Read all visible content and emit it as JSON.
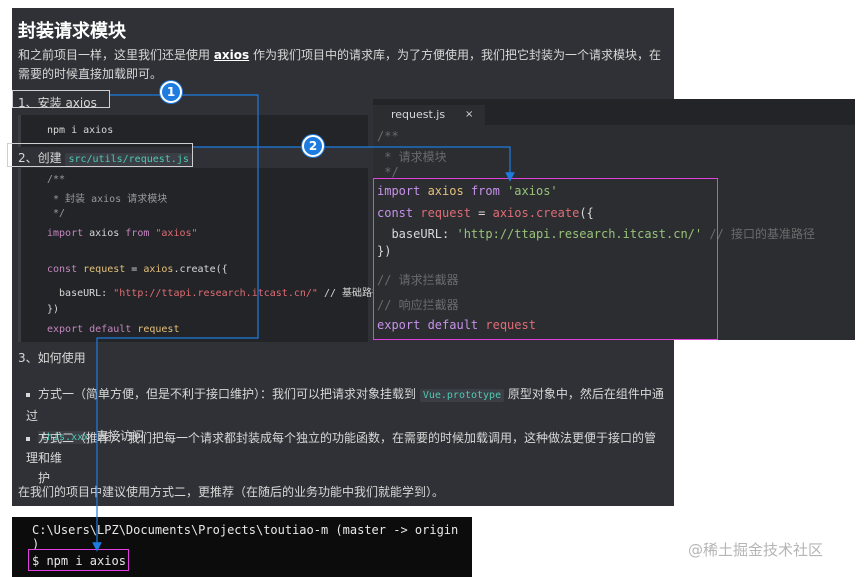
{
  "doc": {
    "title": "封装请求模块",
    "intro_before": "和之前项目一样，这里我们还是使用 ",
    "intro_kw": "axios",
    "intro_after": " 作为我们项目中的请求库，为了方便使用，我们把它封装为一个请求模块，在需要的时候直接加载即可。",
    "step1": "1、安装 axios",
    "step1_code": "npm i axios",
    "step2_prefix": "2、创建 ",
    "step2_file": "src/utils/request.js",
    "code_comment1": "/**",
    "code_comment2": " * 封装 axios 请求模块",
    "code_comment3": " */",
    "code_import_kw": "import",
    "code_import_id": " axios ",
    "code_import_from": "from",
    "code_import_str": " \"axios\"",
    "code_const_kw": "const",
    "code_const_var": " request ",
    "code_const_eq": "= ",
    "code_const_obj": "axios",
    "code_const_call": ".create({",
    "code_base_key": "  baseURL: ",
    "code_base_val": "\"http://ttapi.research.itcast.cn/\"",
    "code_base_com": " // 基础路径",
    "code_close": "})",
    "code_export_kw": "export default",
    "code_export_var": " request",
    "step3": "3、如何使用",
    "bullet1_a": "方式一（简单方便，但是不利于接口维护）：我们可以把请求对象挂载到 ",
    "bullet1_code": "Vue.prototype",
    "bullet1_b": " 原型对象中，然后在组件中通过",
    "bullet1_code2": "this.xxx",
    "bullet1_c": " 直接访问",
    "bullet2_a": "方式二（推荐）：我们把每一个请求都封装成每个独立的功能函数，在需要的时候加载调用，这种做法更便于接口的管理和维",
    "bullet2_b": "护",
    "footer": "在我们的项目中建议使用方式二，更推荐（在随后的业务功能中我们就能学到）。"
  },
  "editor": {
    "tab_label": "request.js",
    "tab_close": "×",
    "c1": "/**",
    "c2": " * 请求模块",
    "c3": " */",
    "l_import_kw": "import",
    "l_import_id": " axios ",
    "l_import_from": "from",
    "l_import_str": " 'axios'",
    "l_const_kw": "const",
    "l_const_var": " request ",
    "l_const_eq": "= ",
    "l_const_obj": "axios",
    "l_const_fn": ".create",
    "l_const_paren": "({",
    "l_base_key": "  baseURL: ",
    "l_base_val": "'http://ttapi.research.itcast.cn/'",
    "l_base_com": " // 接口的基准路径",
    "l_close": "})",
    "l_req_com": "// 请求拦截器",
    "l_res_com": "// 响应拦截器",
    "l_export_kw": "export default",
    "l_export_var": " request"
  },
  "terminal": {
    "path": "C:\\Users\\LPZ\\Documents\\Projects\\toutiao-m (master -> origin",
    "path2": ")",
    "command": "$ npm i axios"
  },
  "markers": {
    "m1": "1",
    "m2": "2"
  },
  "colors": {
    "accent": "#1e7be0",
    "highlight": "#e040e0"
  },
  "watermark": "@稀土掘金技术社区"
}
